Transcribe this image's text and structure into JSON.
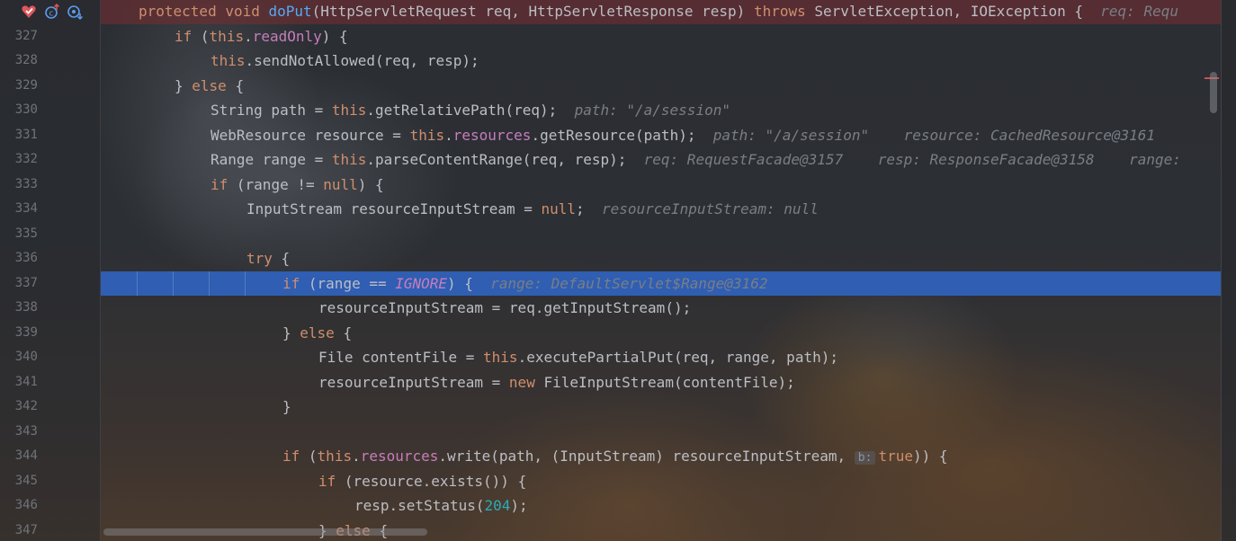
{
  "gutter_icons": [
    "breakpoint-icon",
    "override-icon",
    "step-into-icon"
  ],
  "lines": [
    {
      "num": "",
      "type": "breakpoint",
      "indent": 1,
      "tokens": [
        {
          "c": "kw",
          "t": "protected void "
        },
        {
          "c": "fn",
          "t": "doPut"
        },
        {
          "c": "",
          "t": "(HttpServletRequest req, HttpServletResponse resp) "
        },
        {
          "c": "kw",
          "t": "throws "
        },
        {
          "c": "",
          "t": "ServletException, IOException {  "
        },
        {
          "c": "hint",
          "t": "req: Requ"
        }
      ]
    },
    {
      "num": "327",
      "indent": 2,
      "tokens": [
        {
          "c": "kw",
          "t": "if "
        },
        {
          "c": "",
          "t": "("
        },
        {
          "c": "kw",
          "t": "this"
        },
        {
          "c": "",
          "t": "."
        },
        {
          "c": "fld",
          "t": "readOnly"
        },
        {
          "c": "",
          "t": ") {"
        }
      ]
    },
    {
      "num": "328",
      "indent": 3,
      "tokens": [
        {
          "c": "kw",
          "t": "this"
        },
        {
          "c": "",
          "t": ".sendNotAllowed(req, resp);"
        }
      ]
    },
    {
      "num": "329",
      "indent": 2,
      "tokens": [
        {
          "c": "",
          "t": "} "
        },
        {
          "c": "kw",
          "t": "else "
        },
        {
          "c": "",
          "t": "{"
        }
      ]
    },
    {
      "num": "330",
      "indent": 3,
      "tokens": [
        {
          "c": "",
          "t": "String path = "
        },
        {
          "c": "kw",
          "t": "this"
        },
        {
          "c": "",
          "t": ".getRelativePath(req);  "
        },
        {
          "c": "hint",
          "t": "path: \"/a/session\""
        }
      ]
    },
    {
      "num": "331",
      "indent": 3,
      "tokens": [
        {
          "c": "",
          "t": "WebResource resource = "
        },
        {
          "c": "kw",
          "t": "this"
        },
        {
          "c": "",
          "t": "."
        },
        {
          "c": "fld",
          "t": "resources"
        },
        {
          "c": "",
          "t": ".getResource(path);  "
        },
        {
          "c": "hint",
          "t": "path: \"/a/session\"    resource: CachedResource@3161"
        }
      ]
    },
    {
      "num": "332",
      "indent": 3,
      "tokens": [
        {
          "c": "",
          "t": "Range range = "
        },
        {
          "c": "kw",
          "t": "this"
        },
        {
          "c": "",
          "t": ".parseContentRange(req, resp);  "
        },
        {
          "c": "hint",
          "t": "req: RequestFacade@3157    resp: ResponseFacade@3158    range:"
        }
      ]
    },
    {
      "num": "333",
      "indent": 3,
      "tokens": [
        {
          "c": "kw",
          "t": "if "
        },
        {
          "c": "",
          "t": "(range != "
        },
        {
          "c": "kw",
          "t": "null"
        },
        {
          "c": "",
          "t": ") {"
        }
      ]
    },
    {
      "num": "334",
      "indent": 4,
      "tokens": [
        {
          "c": "",
          "t": "InputStream resourceInputStream = "
        },
        {
          "c": "kw",
          "t": "null"
        },
        {
          "c": "",
          "t": ";  "
        },
        {
          "c": "hint",
          "t": "resourceInputStream: null"
        }
      ]
    },
    {
      "num": "335",
      "indent": 0,
      "tokens": []
    },
    {
      "num": "336",
      "indent": 4,
      "tokens": [
        {
          "c": "kw",
          "t": "try "
        },
        {
          "c": "",
          "t": "{"
        }
      ]
    },
    {
      "num": "337",
      "type": "current",
      "indent": 5,
      "tokens": [
        {
          "c": "kw",
          "t": "if "
        },
        {
          "c": "",
          "t": "(range == "
        },
        {
          "c": "it",
          "t": "IGNORE"
        },
        {
          "c": "",
          "t": ") {  "
        },
        {
          "c": "hint",
          "t": "range: DefaultServlet$Range@3162"
        }
      ]
    },
    {
      "num": "338",
      "indent": 6,
      "tokens": [
        {
          "c": "",
          "t": "resourceInputStream = req.getInputStream();"
        }
      ]
    },
    {
      "num": "339",
      "indent": 5,
      "tokens": [
        {
          "c": "",
          "t": "} "
        },
        {
          "c": "kw",
          "t": "else "
        },
        {
          "c": "",
          "t": "{"
        }
      ]
    },
    {
      "num": "340",
      "indent": 6,
      "tokens": [
        {
          "c": "",
          "t": "File contentFile = "
        },
        {
          "c": "kw",
          "t": "this"
        },
        {
          "c": "",
          "t": ".executePartialPut(req, range, path);"
        }
      ]
    },
    {
      "num": "341",
      "indent": 6,
      "tokens": [
        {
          "c": "",
          "t": "resourceInputStream = "
        },
        {
          "c": "kw",
          "t": "new "
        },
        {
          "c": "",
          "t": "FileInputStream(contentFile);"
        }
      ]
    },
    {
      "num": "342",
      "indent": 5,
      "tokens": [
        {
          "c": "",
          "t": "}"
        }
      ]
    },
    {
      "num": "343",
      "indent": 0,
      "tokens": []
    },
    {
      "num": "344",
      "indent": 5,
      "tokens": [
        {
          "c": "kw",
          "t": "if "
        },
        {
          "c": "",
          "t": "("
        },
        {
          "c": "kw",
          "t": "this"
        },
        {
          "c": "",
          "t": "."
        },
        {
          "c": "fld",
          "t": "resources"
        },
        {
          "c": "",
          "t": ".write(path, (InputStream) resourceInputStream, "
        },
        {
          "c": "param",
          "t": "b:"
        },
        {
          "c": "kw",
          "t": "true"
        },
        {
          "c": "",
          "t": ")) {"
        }
      ]
    },
    {
      "num": "345",
      "indent": 6,
      "tokens": [
        {
          "c": "kw",
          "t": "if "
        },
        {
          "c": "",
          "t": "(resource.exists()) {"
        }
      ]
    },
    {
      "num": "346",
      "indent": 7,
      "tokens": [
        {
          "c": "",
          "t": "resp.setStatus("
        },
        {
          "c": "num",
          "t": "204"
        },
        {
          "c": "",
          "t": ");"
        }
      ]
    },
    {
      "num": "347",
      "indent": 6,
      "tokens": [
        {
          "c": "",
          "t": "} "
        },
        {
          "c": "kw",
          "t": "else "
        },
        {
          "c": "",
          "t": "{"
        }
      ]
    }
  ]
}
